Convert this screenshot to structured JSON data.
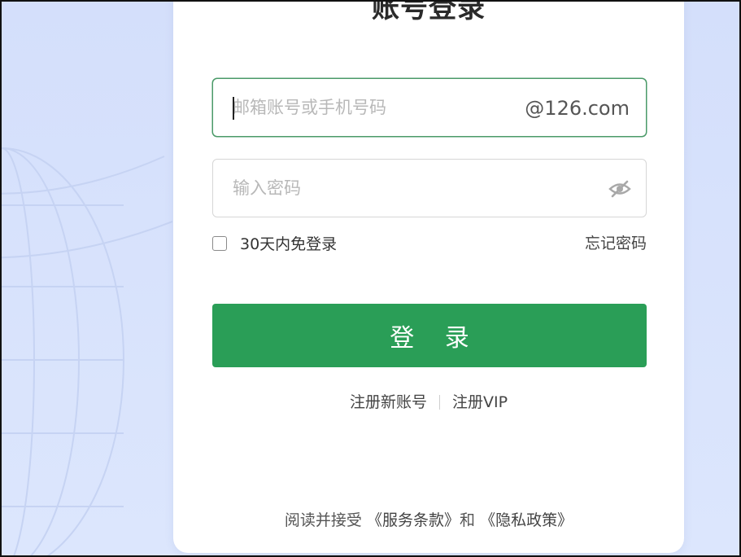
{
  "login": {
    "title": "账号登录",
    "account": {
      "placeholder": "邮箱账号或手机号码",
      "value": "",
      "suffix": "@126.com"
    },
    "password": {
      "placeholder": "输入密码",
      "value": ""
    },
    "remember": {
      "label": "30天内免登录",
      "checked": false
    },
    "forgot_label": "忘记密码",
    "submit_label": "登 录",
    "register_label": "注册新账号",
    "vip_label": "注册VIP",
    "terms": {
      "prefix": "阅读并接受",
      "service_link": "《服务条款》",
      "conjunction": "和",
      "privacy_link": "《隐私政策》"
    }
  },
  "theme": {
    "accent": "#2a9e57",
    "focus_border": "#4a9a68",
    "background": "#d8e2fb"
  },
  "icons": {
    "eye": "eye-off-icon",
    "corner": "corner-mark-icon"
  }
}
